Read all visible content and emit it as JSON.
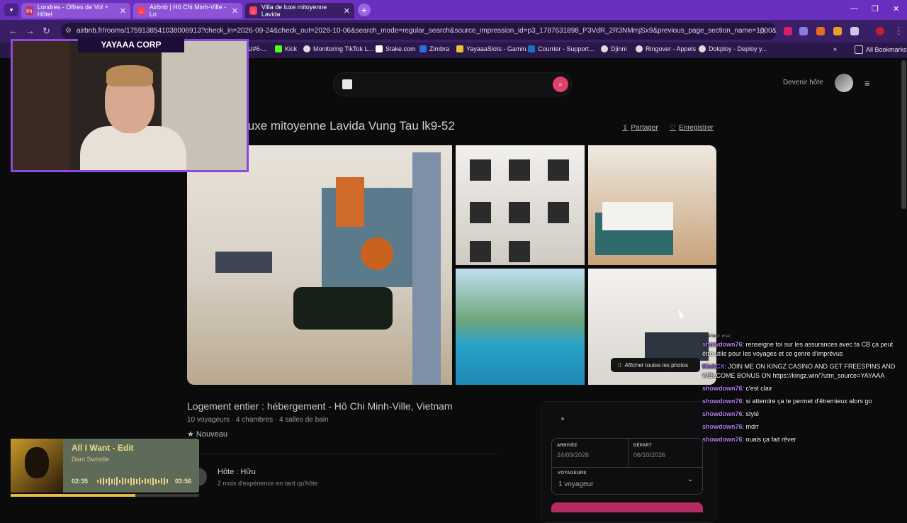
{
  "browser": {
    "tabs": [
      {
        "label": "Londres - Offres de Vol + Hôtel"
      },
      {
        "label": "Airbnb | Hô Chi Minh-Ville - Lo"
      },
      {
        "label": "Villa de luxe mitoyenne Lavida"
      }
    ],
    "url": "airbnb.fr/rooms/1759138541038006913?check_in=2026-09-24&check_out=2026-10-06&search_mode=regular_search&source_impression_id=p3_1787631898_P3VdR_2R3NMmjSx9&previous_page_section_name=1000&federated_...",
    "bookmarks": [
      {
        "label": "U#6-..."
      },
      {
        "label": "Kick"
      },
      {
        "label": "Monitoring TikTok L..."
      },
      {
        "label": "Stake.com"
      },
      {
        "label": "Zimbra"
      },
      {
        "label": "YayaaaSlots - Gamin..."
      },
      {
        "label": "Courrier - Support..."
      },
      {
        "label": "Djinni"
      },
      {
        "label": "Ringover - Appels"
      },
      {
        "label": "Dokploy - Deploy y..."
      }
    ],
    "all_bookmarks": "All Bookmarks"
  },
  "webcam": {
    "title": "YAYAAA CORP"
  },
  "header": {
    "host_link": "Devenir hôte"
  },
  "listing": {
    "title": "luxe mitoyenne Lavida Vung Tau lk9-52",
    "share": "Partager",
    "save": "Enregistrer",
    "show_photos": "Afficher toutes les photos",
    "subtitle": "Logement entier : hébergement - Hô Chi Minh-Ville, Vietnam",
    "details": "10 voyageurs · 4 chambres · 4 salles de bain",
    "new_badge": "★ Nouveau",
    "host_name": "Hôte : Hữu",
    "host_experience": "2 mois d'expérience en tant qu'hôte"
  },
  "booking": {
    "arrival_label": "ARRIVÉE",
    "arrival_value": "24/09/2026",
    "departure_label": "DÉPART",
    "departure_value": "06/10/2026",
    "guests_label": "VOYAGEURS",
    "guests_value": "1 voyageur"
  },
  "chat": {
    "faded_line": "... c'est mal ...",
    "messages": [
      {
        "user": "showdown76",
        "text": ": renseigne toi sur les assurances avec ta CB ça peut être utile pour les voyages et ce genre d'imprévus"
      },
      {
        "user": "KickCX",
        "text": ": JOIN ME ON KINGZ CASINO AND GET FREESPINS AND WELCOME BONUS ON https://kingz.win/?utm_source=YAYAAA"
      },
      {
        "user": "showdown76",
        "text": ": c'est clair"
      },
      {
        "user": "showdown76",
        "text": ": si attendre ça te permet d'êtremieux alors go"
      },
      {
        "user": "showdown76",
        "text": ": stylé"
      },
      {
        "user": "showdown76",
        "text": ": mdrr"
      },
      {
        "user": "showdown76",
        "text": ": ouais ça fait rêver"
      }
    ]
  },
  "music": {
    "song": "All I Want - Edit",
    "artist": "Dam Swindle",
    "elapsed": "02:35",
    "duration": "03:56",
    "progress": 0.66
  },
  "colors": {
    "accent": "#6b2fbf",
    "airbnb": "#e0406a",
    "chat_user": "#b07ef0"
  }
}
